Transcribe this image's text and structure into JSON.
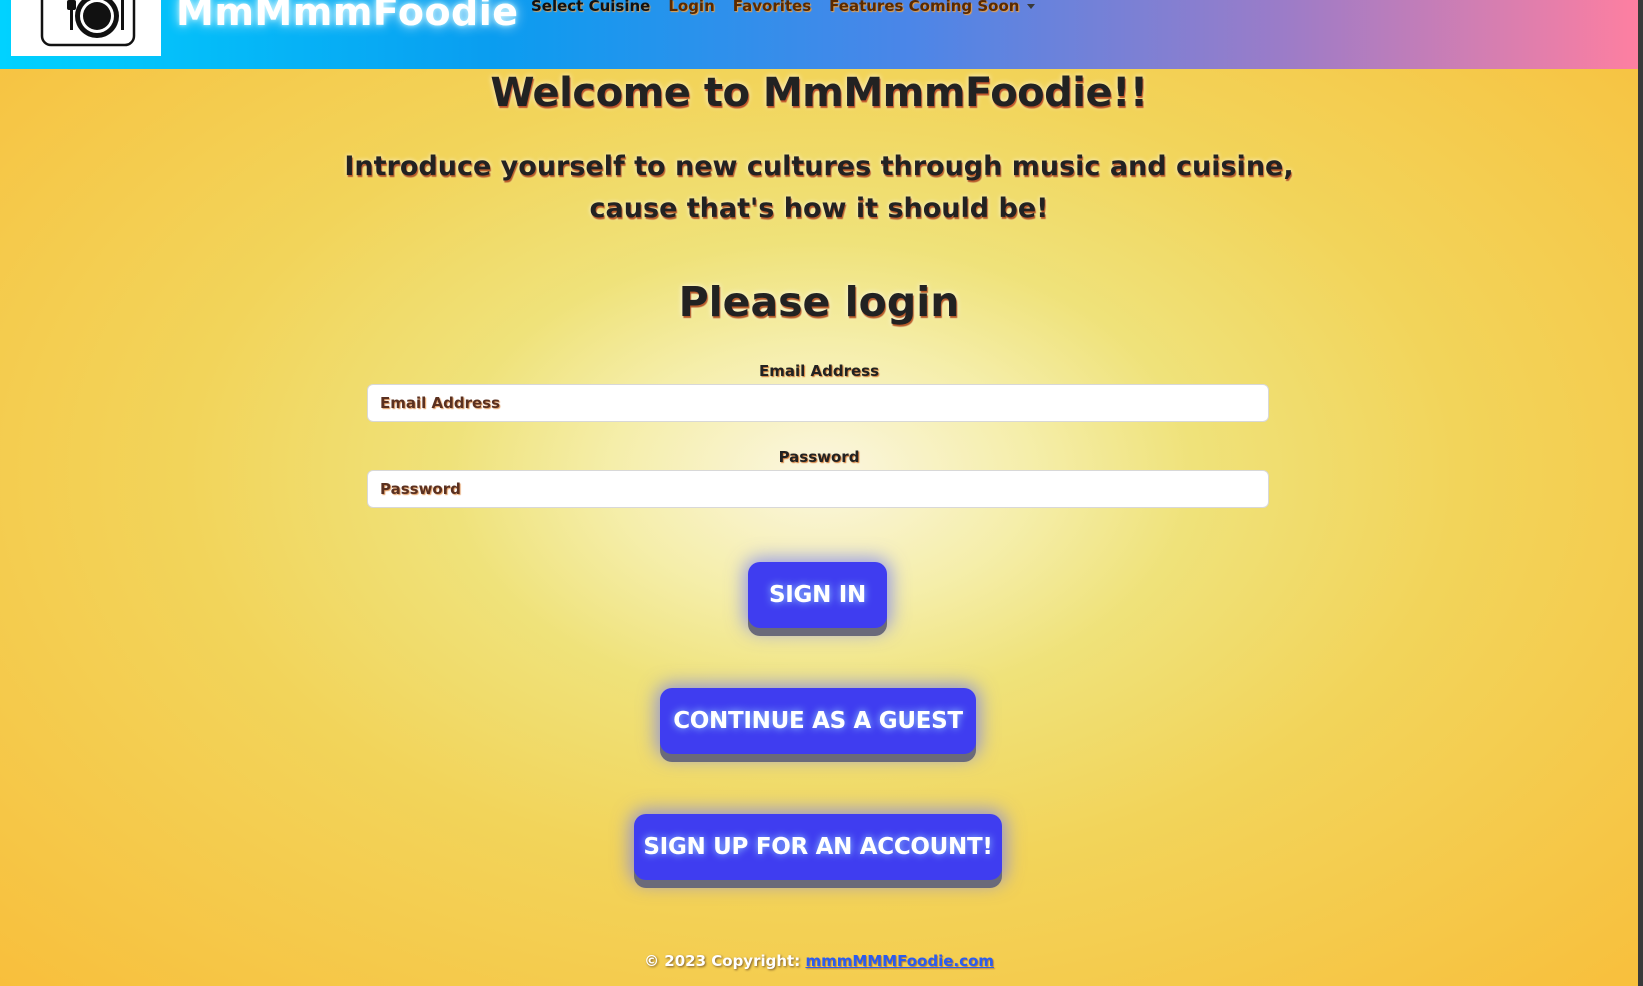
{
  "navbar": {
    "brand": "MmMmmFoodie",
    "links": [
      {
        "label": "Select Cuisine"
      },
      {
        "label": "Login"
      },
      {
        "label": "Favorites"
      },
      {
        "label": "Features Coming Soon"
      }
    ]
  },
  "main": {
    "welcome_title": "Welcome to MmMmmFoodie!!",
    "tagline_line1": "Introduce yourself to new cultures through music and cuisine,",
    "tagline_line2": "cause that's how it should be!",
    "login_heading": "Please login",
    "email_label": "Email Address",
    "email_placeholder": "Email Address",
    "password_label": "Password",
    "password_placeholder": "Password",
    "sign_in_button": "SIGN IN",
    "guest_button": "CONTINUE AS A GUEST",
    "signup_button": "SIGN UP FOR AN ACCOUNT!"
  },
  "footer": {
    "copyright": "© 2023 Copyright: ",
    "link_text": "mmmMMMFoodie.com"
  },
  "colors": {
    "button": "#3f3df0",
    "nav_gradient_start": "#00d2ff",
    "nav_gradient_end": "#ff7fa0",
    "footer_link": "#2a5cf0"
  }
}
